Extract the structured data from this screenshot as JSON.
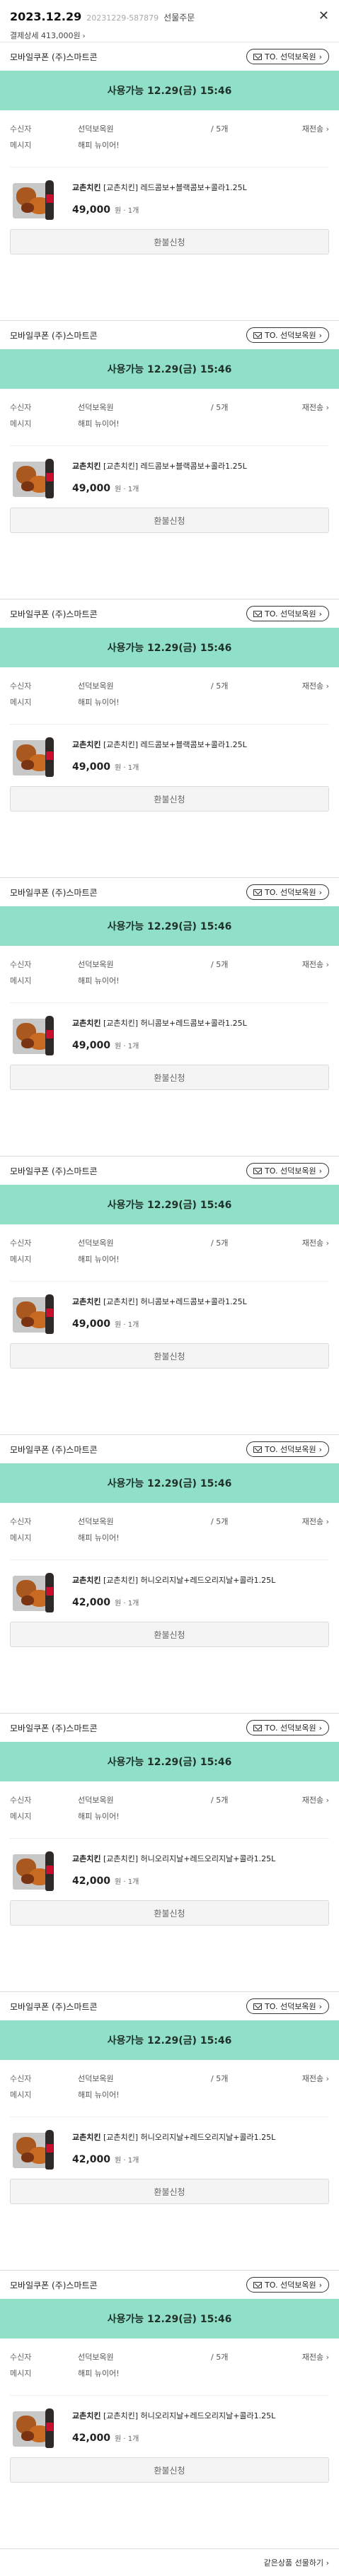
{
  "header": {
    "date": "2023.12.29",
    "order_no": "20231229-587879",
    "order_type": "선물주문",
    "payment_detail": "결제상세 413,000원",
    "chevron": "›",
    "close": "✕"
  },
  "cards": [
    {
      "brand": "모바일쿠폰 (주)스마트콘",
      "to_label": "TO. 선덕보옥원",
      "usable": "사용가능 12.29(금) 15:46",
      "recipient_label": "수신자",
      "recipient": "선덕보옥원",
      "count": "/ 5개",
      "resend": "재전송",
      "message_label": "메시지",
      "message": "해피 뉴이어!",
      "product_brand": "교촌치킨",
      "product_name": "[교촌치킨] 레드콤보+블랙콤보+콜라1.25L",
      "price": "49,000",
      "unit": "원 · 1개",
      "refund": "환불신청"
    },
    {
      "brand": "모바일쿠폰 (주)스마트콘",
      "to_label": "TO. 선덕보옥원",
      "usable": "사용가능 12.29(금) 15:46",
      "recipient_label": "수신자",
      "recipient": "선덕보옥원",
      "count": "/ 5개",
      "resend": "재전송",
      "message_label": "메시지",
      "message": "해피 뉴이어!",
      "product_brand": "교촌치킨",
      "product_name": "[교촌치킨] 레드콤보+블랙콤보+콜라1.25L",
      "price": "49,000",
      "unit": "원 · 1개",
      "refund": "환불신청"
    },
    {
      "brand": "모바일쿠폰 (주)스마트콘",
      "to_label": "TO. 선덕보옥원",
      "usable": "사용가능 12.29(금) 15:46",
      "recipient_label": "수신자",
      "recipient": "선덕보옥원",
      "count": "/ 5개",
      "resend": "재전송",
      "message_label": "메시지",
      "message": "해피 뉴이어!",
      "product_brand": "교촌치킨",
      "product_name": "[교촌치킨] 레드콤보+블랙콤보+콜라1.25L",
      "price": "49,000",
      "unit": "원 · 1개",
      "refund": "환불신청"
    },
    {
      "brand": "모바일쿠폰 (주)스마트콘",
      "to_label": "TO. 선덕보옥원",
      "usable": "사용가능 12.29(금) 15:46",
      "recipient_label": "수신자",
      "recipient": "선덕보옥원",
      "count": "/ 5개",
      "resend": "재전송",
      "message_label": "메시지",
      "message": "해피 뉴이어!",
      "product_brand": "교촌치킨",
      "product_name": "[교촌치킨] 허니콤보+레드콤보+콜라1.25L",
      "price": "49,000",
      "unit": "원 · 1개",
      "refund": "환불신청"
    },
    {
      "brand": "모바일쿠폰 (주)스마트콘",
      "to_label": "TO. 선덕보옥원",
      "usable": "사용가능 12.29(금) 15:46",
      "recipient_label": "수신자",
      "recipient": "선덕보옥원",
      "count": "/ 5개",
      "resend": "재전송",
      "message_label": "메시지",
      "message": "해피 뉴이어!",
      "product_brand": "교촌치킨",
      "product_name": "[교촌치킨] 허니콤보+레드콤보+콜라1.25L",
      "price": "49,000",
      "unit": "원 · 1개",
      "refund": "환불신청"
    },
    {
      "brand": "모바일쿠폰 (주)스마트콘",
      "to_label": "TO. 선덕보옥원",
      "usable": "사용가능 12.29(금) 15:46",
      "recipient_label": "수신자",
      "recipient": "선덕보옥원",
      "count": "/ 5개",
      "resend": "재전송",
      "message_label": "메시지",
      "message": "해피 뉴이어!",
      "product_brand": "교촌치킨",
      "product_name": "[교촌치킨] 허니오리지날+레드오리지날+콜라1.25L",
      "price": "42,000",
      "unit": "원 · 1개",
      "refund": "환불신청"
    },
    {
      "brand": "모바일쿠폰 (주)스마트콘",
      "to_label": "TO. 선덕보옥원",
      "usable": "사용가능 12.29(금) 15:46",
      "recipient_label": "수신자",
      "recipient": "선덕보옥원",
      "count": "/ 5개",
      "resend": "재전송",
      "message_label": "메시지",
      "message": "해피 뉴이어!",
      "product_brand": "교촌치킨",
      "product_name": "[교촌치킨] 허니오리지날+레드오리지날+콜라1.25L",
      "price": "42,000",
      "unit": "원 · 1개",
      "refund": "환불신청"
    },
    {
      "brand": "모바일쿠폰 (주)스마트콘",
      "to_label": "TO. 선덕보옥원",
      "usable": "사용가능 12.29(금) 15:46",
      "recipient_label": "수신자",
      "recipient": "선덕보옥원",
      "count": "/ 5개",
      "resend": "재전송",
      "message_label": "메시지",
      "message": "해피 뉴이어!",
      "product_brand": "교촌치킨",
      "product_name": "[교촌치킨] 허니오리지날+레드오리지날+콜라1.25L",
      "price": "42,000",
      "unit": "원 · 1개",
      "refund": "환불신청"
    },
    {
      "brand": "모바일쿠폰 (주)스마트콘",
      "to_label": "TO. 선덕보옥원",
      "usable": "사용가능 12.29(금) 15:46",
      "recipient_label": "수신자",
      "recipient": "선덕보옥원",
      "count": "/ 5개",
      "resend": "재전송",
      "message_label": "메시지",
      "message": "해피 뉴이어!",
      "product_brand": "교촌치킨",
      "product_name": "[교촌치킨] 허니오리지날+레드오리지날+콜라1.25L",
      "price": "42,000",
      "unit": "원 · 1개",
      "refund": "환불신청"
    }
  ],
  "footer": {
    "gift_again": "같은상품 선물하기 ›"
  },
  "colors": {
    "banner": "#8fe0c7",
    "refund_bg": "#f4f4f4"
  }
}
